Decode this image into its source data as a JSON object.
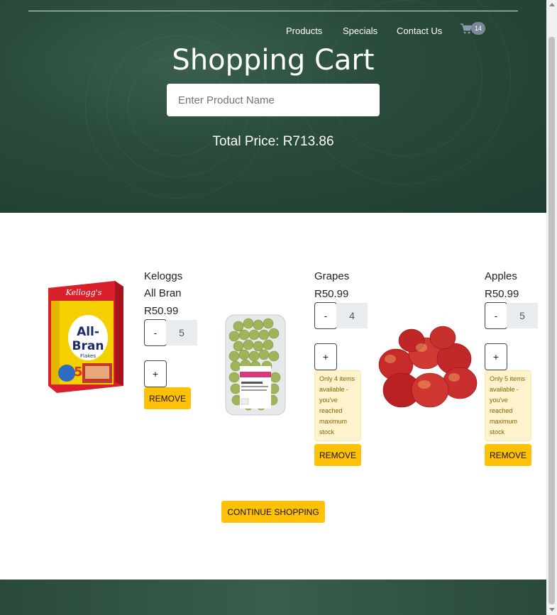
{
  "nav": {
    "items": [
      "Products",
      "Specials",
      "Contact Us"
    ],
    "cart_icon": "shopping-cart-icon",
    "cart_count": "14"
  },
  "hero": {
    "title": "Shopping Cart",
    "search_placeholder": "Enter Product Name",
    "total": "Total Price: R713.86"
  },
  "cart": {
    "items": [
      {
        "name_line1": "Keloggs",
        "name_line2": "All Bran",
        "price": "R50.99",
        "quantity": "5",
        "minus": "-",
        "plus": "+",
        "remove": "REMOVE",
        "image": "kelloggs-all-bran-box"
      },
      {
        "name_line1": "Grapes",
        "price": "R50.99",
        "quantity": "4",
        "minus": "-",
        "plus": "+",
        "remove": "REMOVE",
        "image": "green-grapes-punnet",
        "warning": "Only 4 items available - you've reached maximum stock"
      },
      {
        "name_line1": "Apples",
        "price": "R50.99",
        "quantity": "5",
        "minus": "-",
        "plus": "+",
        "remove": "REMOVE",
        "image": "red-apples",
        "warning": "Only 5 items available - you've reached maximum stock"
      }
    ]
  },
  "continue_label": "CONTINUE SHOPPING",
  "colors": {
    "hero_bg": "#2a4b3b",
    "accent": "#ffc107",
    "warning_bg": "#fff3cd",
    "badge": "#7a8a99"
  }
}
